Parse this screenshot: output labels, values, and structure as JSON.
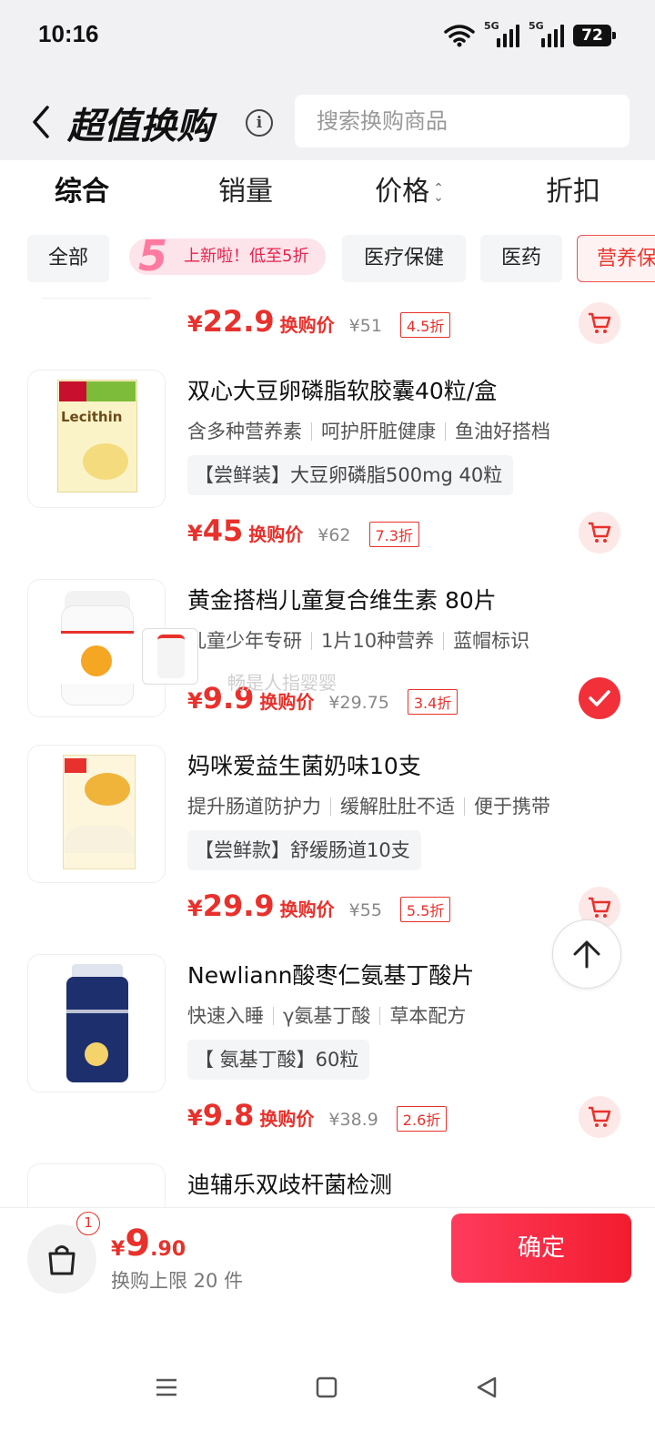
{
  "status": {
    "time": "10:16",
    "battery": "72",
    "sig1": "5G",
    "sig2": "5G"
  },
  "header": {
    "title": "超值换购",
    "search_placeholder": "搜索换购商品"
  },
  "sort_tabs": [
    "综合",
    "销量",
    "价格",
    "折扣"
  ],
  "chips": {
    "all": "全部",
    "promo_num": "5",
    "promo_text": "上新啦！低至5折",
    "medical": "医疗保健",
    "medicine": "医药",
    "nutrition": "营养保"
  },
  "items": [
    {
      "price": "22.9",
      "price_label": "换购价",
      "orig": "¥51",
      "discount": "4.5折"
    },
    {
      "name": "双心大豆卵磷脂软胶囊40粒/盒",
      "tags": [
        "含多种营养素",
        "呵护肝脏健康",
        "鱼油好搭档"
      ],
      "spec": "【尝鲜装】大豆卵磷脂500mg 40粒",
      "price": "45",
      "price_label": "换购价",
      "orig": "¥62",
      "discount": "7.3折"
    },
    {
      "name": "黄金搭档儿童复合维生素 80片",
      "tags": [
        "儿童少年专研",
        "1片10种营养",
        "蓝帽标识"
      ],
      "price": "9.9",
      "price_label": "换购价",
      "orig": "¥29.75",
      "discount": "3.4折"
    },
    {
      "name": "妈咪爱益生菌奶味10支",
      "tags": [
        "提升肠道防护力",
        "缓解肚肚不适",
        "便于携带"
      ],
      "spec": "【尝鲜款】舒缓肠道10支",
      "price": "29.9",
      "price_label": "换购价",
      "orig": "¥55",
      "discount": "5.5折"
    },
    {
      "name": "Newliann酸枣仁氨基丁酸片",
      "tags": [
        "快速入睡",
        "γ氨基丁酸",
        "草本配方"
      ],
      "spec": "【 氨基丁酸】60粒",
      "price": "9.8",
      "price_label": "换购价",
      "orig": "¥38.9",
      "discount": "2.6折"
    },
    {
      "name": "迪辅乐双歧杆菌检测"
    }
  ],
  "watermark": "畅是人指婴婴",
  "bottom": {
    "badge": "1",
    "yen": "¥",
    "int": "9",
    "dec": ".90",
    "limit": "换购上限 20 件",
    "confirm": "确定"
  },
  "colors": {
    "accent": "#e8312c",
    "button": "#f21c2d",
    "header_bg": "#f1f1f3"
  },
  "icons": [
    "back-icon",
    "info-icon",
    "cart-icon",
    "check-icon",
    "arrow-up-icon",
    "shopping-bag-icon",
    "menu-icon",
    "home-icon",
    "back-triangle-icon"
  ]
}
